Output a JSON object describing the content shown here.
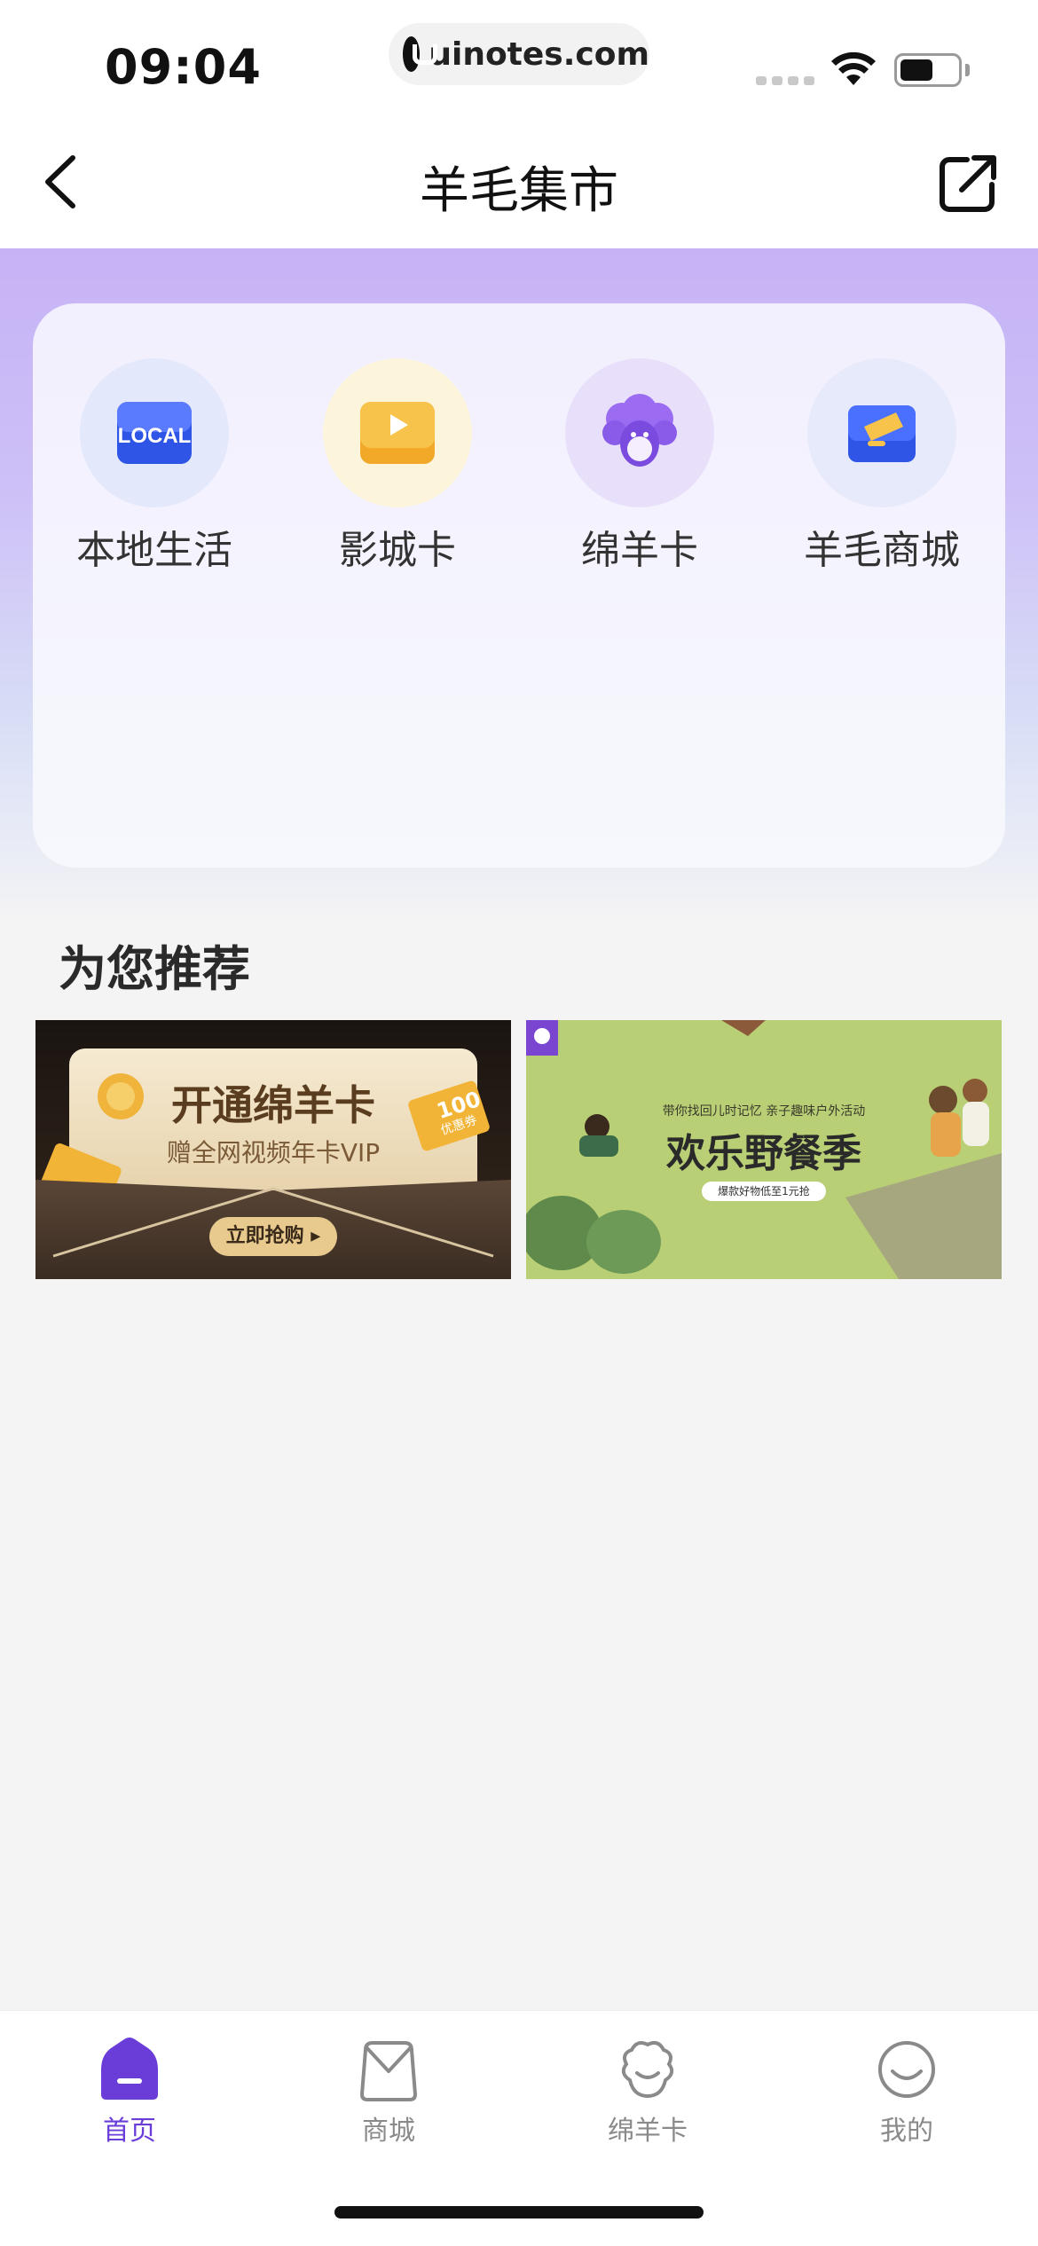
{
  "status_bar": {
    "time": "09:04",
    "url": "uinotes.com"
  },
  "nav": {
    "title": "羊毛集市"
  },
  "services": [
    {
      "label": "本地生活",
      "icon": "local-life-icon",
      "icon_text": "LOCAL"
    },
    {
      "label": "影城卡",
      "icon": "cinema-card-icon"
    },
    {
      "label": "绵羊卡",
      "icon": "sheep-card-icon"
    },
    {
      "label": "羊毛商城",
      "icon": "wool-mall-icon"
    }
  ],
  "recommend": {
    "title": "为您推荐",
    "banners": [
      {
        "title": "开通绵羊卡",
        "subtitle": "赠全网视频年卡VIP",
        "button": "立即抢购 ▸",
        "coupon_value": "100",
        "coupon_unit": "优惠券"
      },
      {
        "top_line": "带你找回儿时记忆 亲子趣味户外活动",
        "title": "欢乐野餐季",
        "bottom_line": "爆款好物低至1元抢"
      }
    ]
  },
  "tab_bar": {
    "items": [
      {
        "label": "首页",
        "icon": "home-icon",
        "active": true
      },
      {
        "label": "商城",
        "icon": "shopping-bag-icon",
        "active": false
      },
      {
        "label": "绵羊卡",
        "icon": "sheep-icon",
        "active": false
      },
      {
        "label": "我的",
        "icon": "profile-smile-icon",
        "active": false
      }
    ]
  },
  "colors": {
    "accent": "#6a3dd8",
    "header_gradient_top": "#c6b3f6",
    "tab_inactive": "#8a8a8a"
  }
}
